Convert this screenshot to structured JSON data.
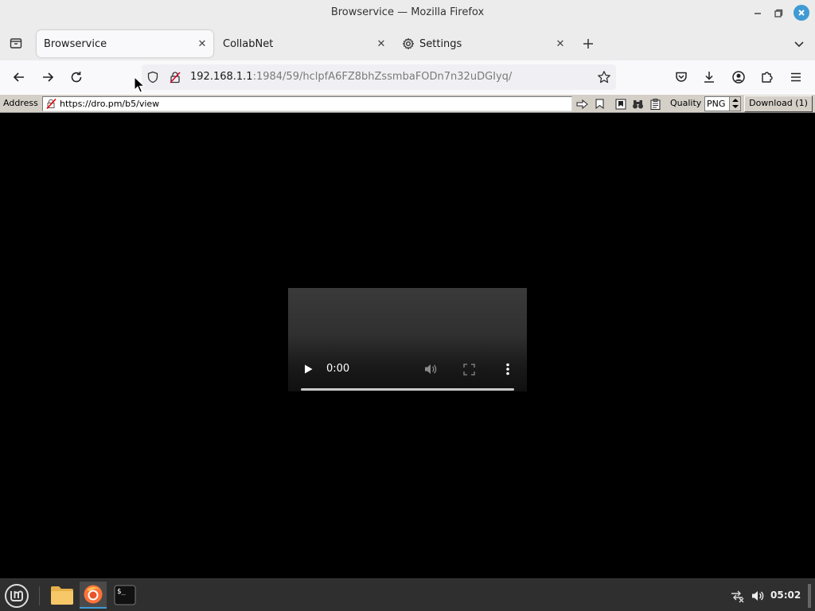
{
  "window": {
    "title": "Browservice — Mozilla Firefox"
  },
  "tabs": [
    {
      "label": "Browservice",
      "active": true
    },
    {
      "label": "CollabNet",
      "active": false
    },
    {
      "label": "Settings",
      "active": false,
      "icon": "gear-icon"
    }
  ],
  "navbar": {
    "url_host": "192.168.1.1",
    "url_rest": ":1984/59/hclpfA6FZ8bhZssmbaFODn7n32uDGIyq/"
  },
  "browservice": {
    "address_label": "Address",
    "address_value": "https://dro.pm/b5/view",
    "quality_label": "Quality",
    "quality_value": "PNG",
    "download_label": "Download (1)"
  },
  "video": {
    "time": "0:00",
    "progress": 0
  },
  "taskbar": {
    "clock": "05:02",
    "active_app": "firefox"
  },
  "colors": {
    "accent": "#3f9bd4",
    "page_background": "#000000",
    "toolbar_gray": "#d4d0c8"
  }
}
